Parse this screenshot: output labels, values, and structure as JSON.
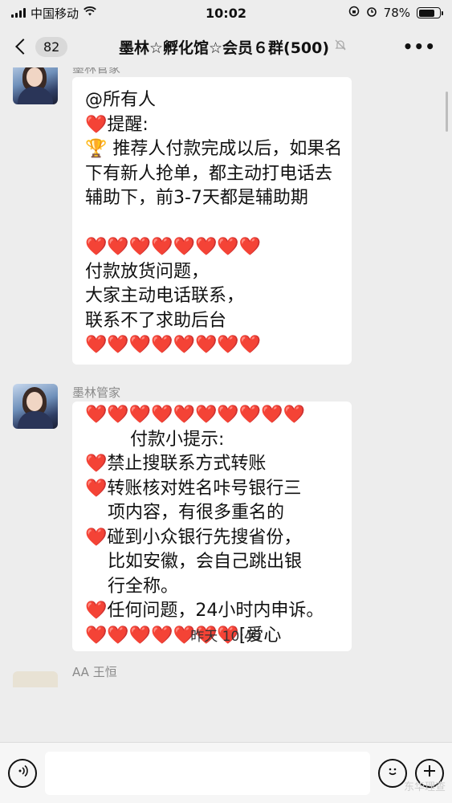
{
  "status_bar": {
    "carrier": "中国移动",
    "time": "10:02",
    "battery_text": "78%",
    "battery_level": 0.78
  },
  "nav": {
    "back_count": "82",
    "title": "墨林☆孵化馆☆会员６群(500)",
    "more_label": "•••"
  },
  "messages": [
    {
      "sender": "墨林管家",
      "text": "@所有人\n❤️提醒:\n🏆 推荐人付款完成以后，如果名\n下有新人抢单，都主动打电话去\n辅助下，前3-7天都是辅助期\n\n❤️❤️❤️❤️❤️❤️❤️❤️\n付款放货问题，\n大家主动电话联系，\n联系不了求助后台\n❤️❤️❤️❤️❤️❤️❤️❤️"
    },
    {
      "sender": "墨林管家",
      "text": "❤️❤️❤️❤️❤️❤️❤️❤️❤️❤️\n        付款小提示:\n❤️禁止搜联系方式转账\n❤️转账核对姓名咔号银行三\n    项内容，有很多重名的\n❤️碰到小众银行先搜省份，\n    比如安徽，会自己跳出银\n    行全称。\n❤️任何问题，24小时内申诉。\n❤️❤️❤️❤️❤️❤️❤️[爱心"
    }
  ],
  "timestamp": "昨天 10:49",
  "partial_sender": "AA 王恒",
  "input_bar": {
    "voice_icon": "voice-icon",
    "emoji_icon": "emoji-icon",
    "plus_icon": "plus-icon",
    "input_value": ""
  },
  "watermark": "东华理查"
}
